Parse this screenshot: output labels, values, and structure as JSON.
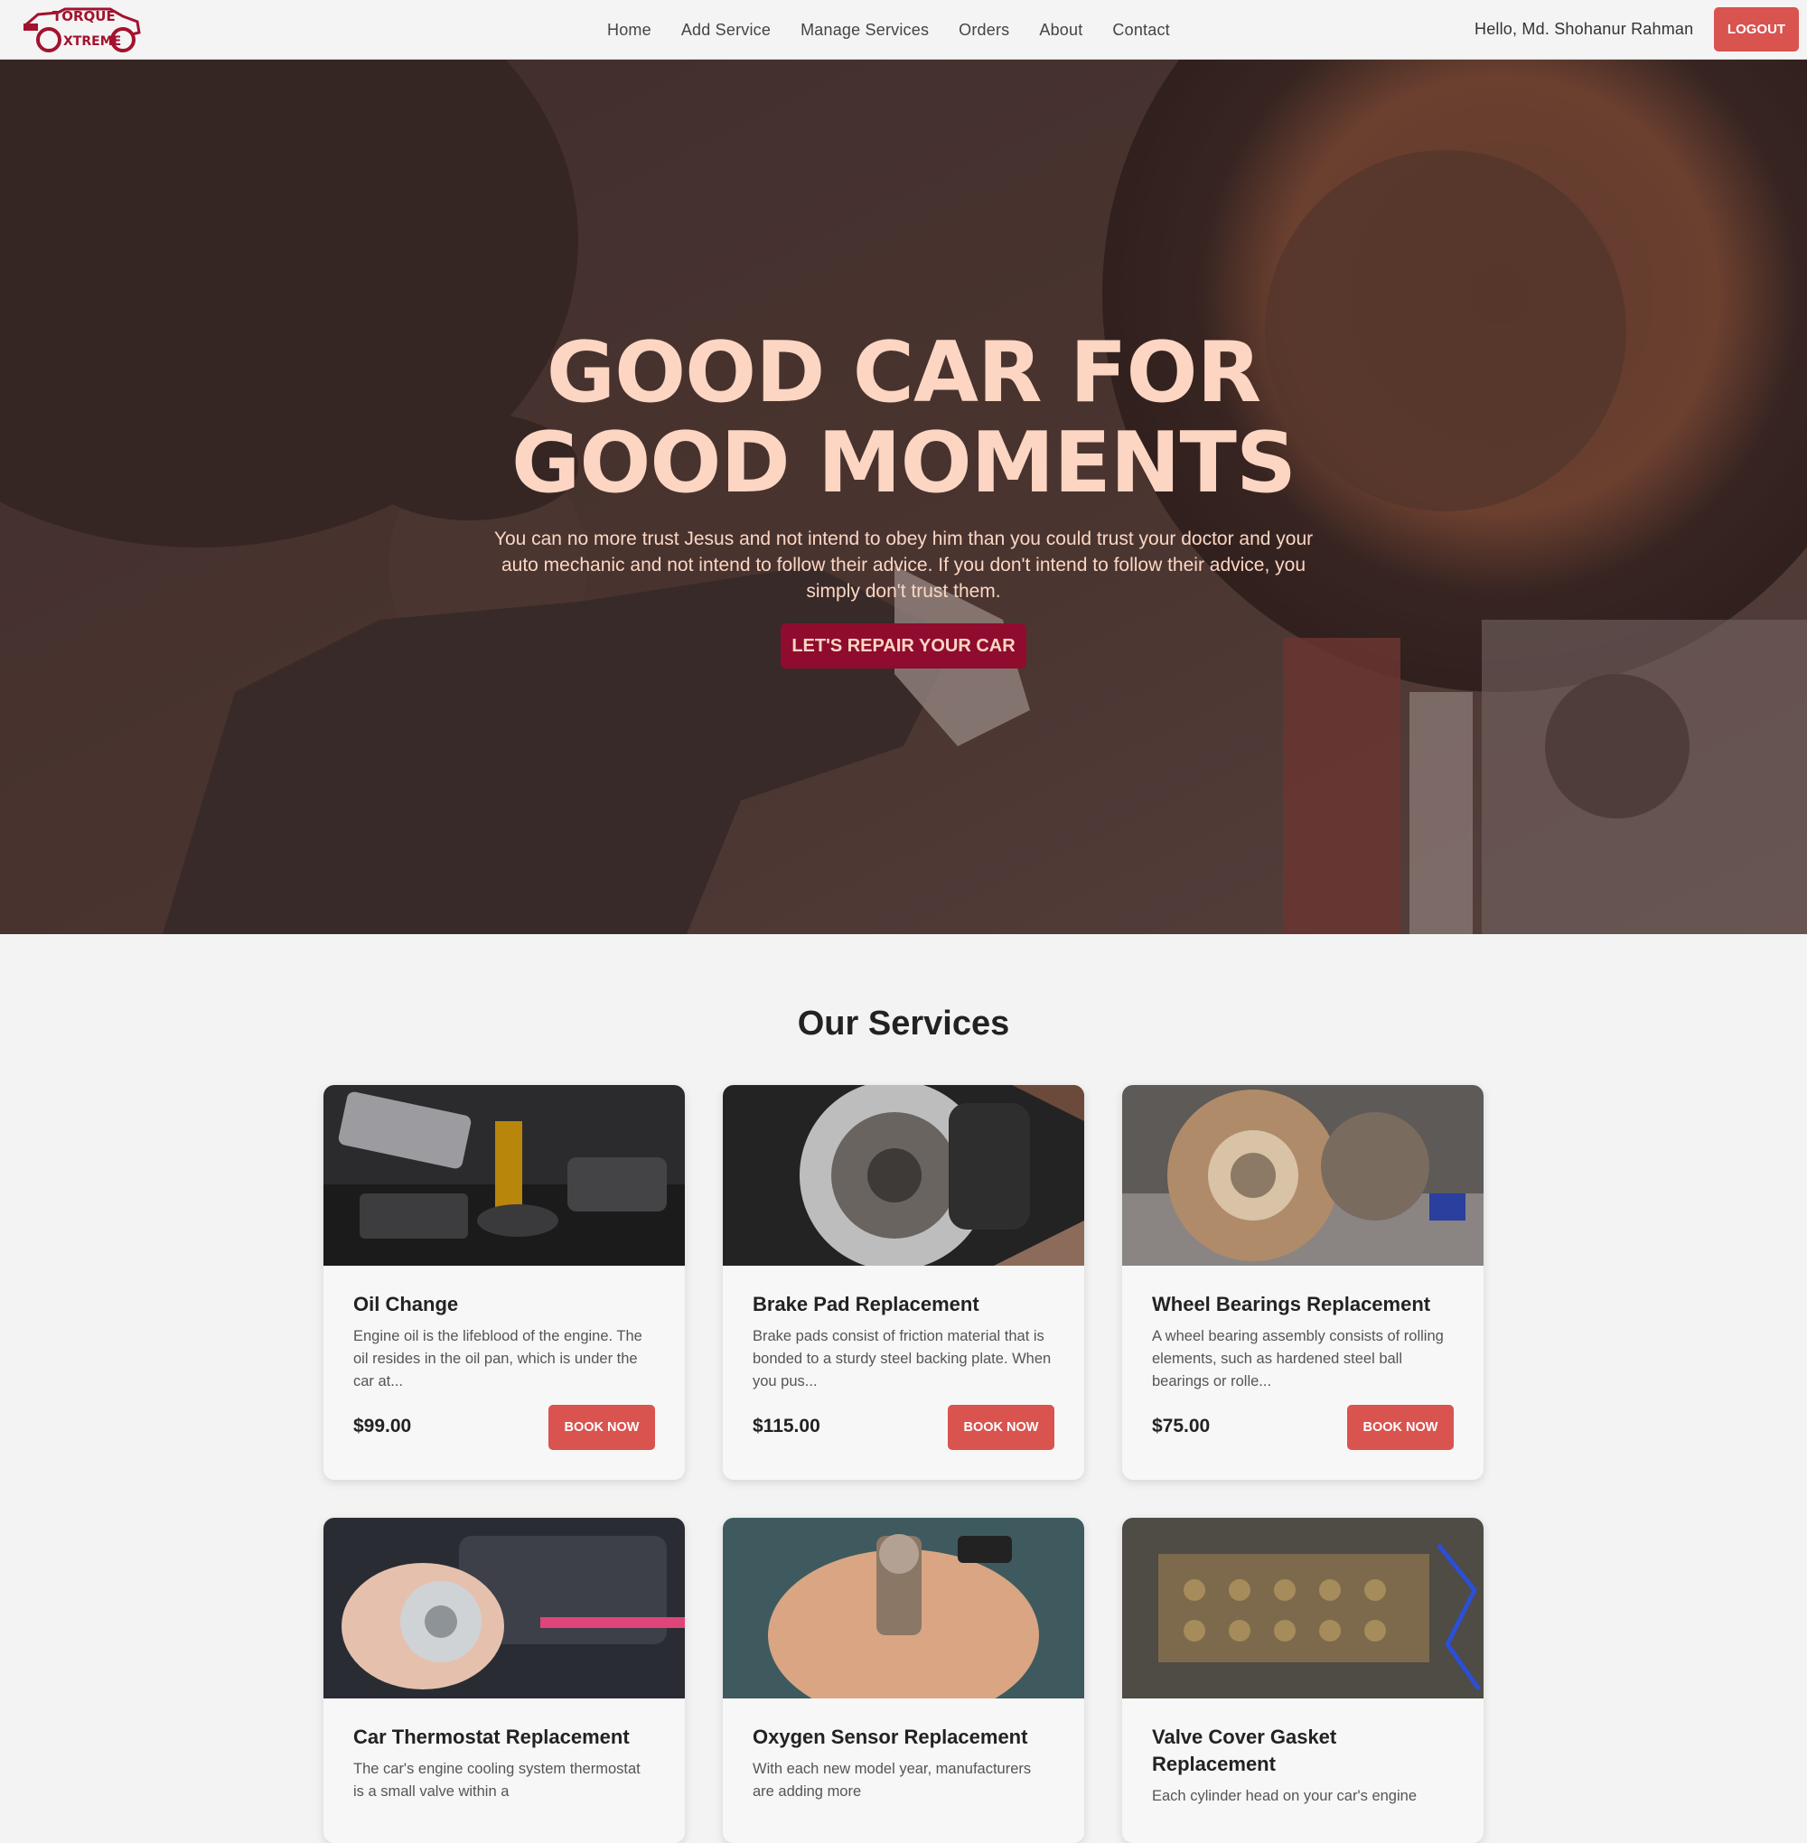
{
  "brand": {
    "line1": "TORQUE",
    "line2": "XTREME",
    "color": "#a3122e"
  },
  "nav": {
    "links": [
      "Home",
      "Add Service",
      "Manage Services",
      "Orders",
      "About",
      "Contact"
    ],
    "greeting": "Hello, Md. Shohanur Rahman",
    "logout_label": "LOGOUT"
  },
  "hero": {
    "title_line1": "GOOD CAR FOR",
    "title_line2": "GOOD MOMENTS",
    "text": "You can no more trust Jesus and not intend to obey him than you could trust your doctor and your auto mechanic and not intend to follow their advice. If you don't intend to follow their advice, you simply don't trust them.",
    "cta_label": "LET'S REPAIR YOUR CAR"
  },
  "services": {
    "title": "Our Services",
    "book_label": "BOOK NOW",
    "items": [
      {
        "title": "Oil Change",
        "desc": "Engine oil is the lifeblood of the engine. The oil resides in the oil pan, which is under the car at...",
        "price": "$99.00",
        "image": "oil-change-photo"
      },
      {
        "title": "Brake Pad Replacement",
        "desc": "Brake pads consist of friction material that is bonded to a sturdy steel backing plate. When you pus...",
        "price": "$115.00",
        "image": "brake-disc-photo"
      },
      {
        "title": "Wheel Bearings Replacement",
        "desc": "A wheel bearing assembly consists of rolling elements, such as hardened steel ball bearings or rolle...",
        "price": "$75.00",
        "image": "wheel-bearing-photo"
      },
      {
        "title": "Car Thermostat Replacement",
        "desc": "The car's engine cooling system thermostat is a small valve within a",
        "price": "",
        "image": "thermostat-photo"
      },
      {
        "title": "Oxygen Sensor Replacement",
        "desc": "With each new model year, manufacturers are adding more",
        "price": "",
        "image": "oxygen-sensor-photo"
      },
      {
        "title": "Valve Cover Gasket Replacement",
        "desc": "Each cylinder head on your car's engine",
        "price": "",
        "image": "valve-cover-photo"
      }
    ]
  },
  "colors": {
    "accent": "#d9534f",
    "hero_button": "#8f0c2f",
    "hero_text": "#fcd6c2"
  }
}
